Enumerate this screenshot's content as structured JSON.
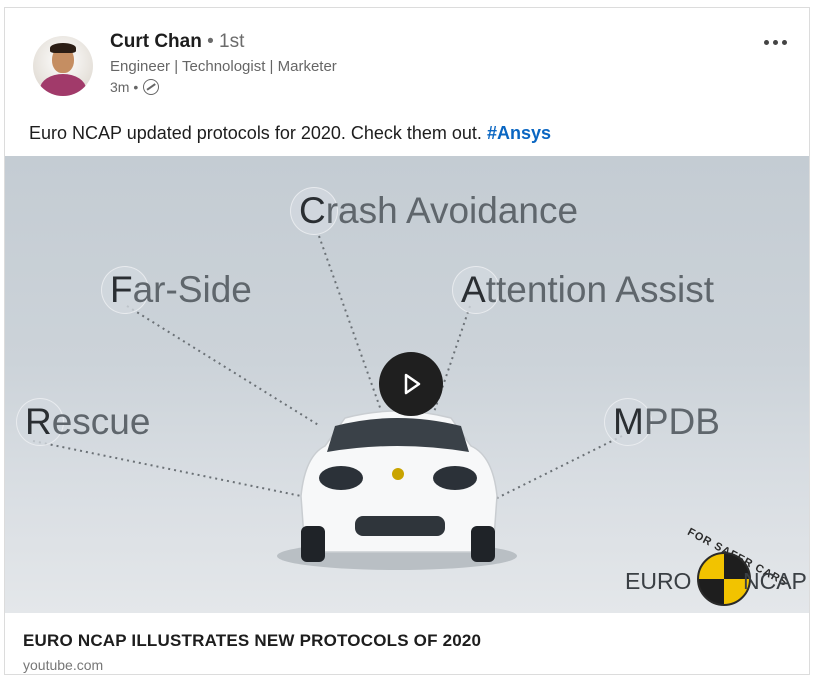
{
  "post": {
    "author": {
      "name": "Curt Chan",
      "degree": "• 1st",
      "headline": "Engineer | Technologist | Marketer",
      "time": "3m •",
      "visibility_icon": "globe-icon"
    },
    "more_icon": "ellipsis-icon",
    "text_before": "Euro NCAP updated protocols for 2020. Check them out. ",
    "hashtag": "#Ansys"
  },
  "video": {
    "labels": [
      {
        "first": "C",
        "rest": "rash Avoidance"
      },
      {
        "first": "F",
        "rest": "ar-Side"
      },
      {
        "first": "A",
        "rest": "ttention Assist"
      },
      {
        "first": "R",
        "rest": "escue"
      },
      {
        "first": "M",
        "rest": "PDB"
      }
    ],
    "play_icon": "play-icon",
    "logo": {
      "left": "EURO",
      "right": "NCAP",
      "tagline": "FOR SAFER CARS"
    }
  },
  "link": {
    "title": "EURO NCAP ILLUSTRATES NEW PROTOCOLS OF 2020",
    "domain": "youtube.com"
  },
  "colors": {
    "hashtag": "#0a66c2",
    "play_button": "#1f1f1f",
    "logo_yellow": "#f2c300"
  }
}
